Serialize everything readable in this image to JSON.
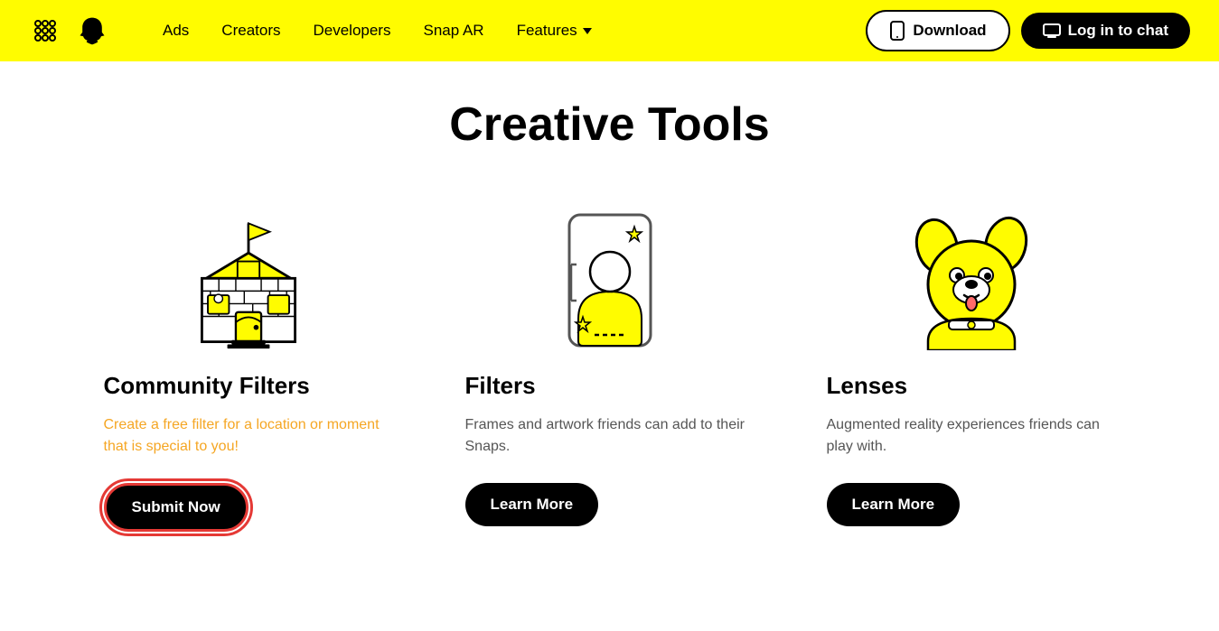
{
  "navbar": {
    "links": [
      {
        "label": "Ads",
        "name": "ads"
      },
      {
        "label": "Creators",
        "name": "creators"
      },
      {
        "label": "Developers",
        "name": "developers"
      },
      {
        "label": "Snap AR",
        "name": "snap-ar"
      },
      {
        "label": "Features",
        "name": "features",
        "hasDropdown": true
      }
    ],
    "download_label": "Download",
    "login_label": "Log in to chat"
  },
  "main": {
    "title": "Creative Tools",
    "cards": [
      {
        "name": "community-filters",
        "title": "Community Filters",
        "description": "Create a free filter for a location or moment that is special to you!",
        "desc_style": "orange",
        "button_label": "Submit Now",
        "button_name": "submit-now-button"
      },
      {
        "name": "filters",
        "title": "Filters",
        "description": "Frames and artwork friends can add to their Snaps.",
        "desc_style": "normal",
        "button_label": "Learn More",
        "button_name": "filters-learn-more-button"
      },
      {
        "name": "lenses",
        "title": "Lenses",
        "description": "Augmented reality experiences friends can play with.",
        "desc_style": "normal",
        "button_label": "Learn More",
        "button_name": "lenses-learn-more-button"
      }
    ]
  }
}
